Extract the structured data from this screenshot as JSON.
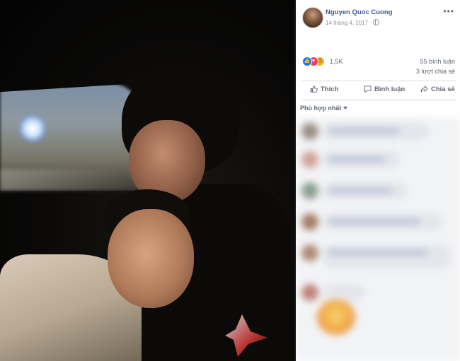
{
  "post": {
    "author": "Nguyen Quoc Cuong",
    "date": "14 tháng 4, 2017 ·",
    "privacy_icon": "globe-icon",
    "more_icon": "more-dots-icon"
  },
  "stats": {
    "reaction_count": "1,5K",
    "reaction_icons": [
      "like-icon",
      "love-icon",
      "sad-icon"
    ],
    "comments": "55 bình luận",
    "shares": "3 lượt chia sẻ"
  },
  "actions": {
    "like": "Thích",
    "comment": "Bình luận",
    "share": "Chia sẻ"
  },
  "comments_section": {
    "sort_label": "Phù hợp nhất"
  },
  "colors": {
    "link_blue": "#385898",
    "like_blue": "#1877f2",
    "love_red": "#f33e58",
    "sad_yellow": "#f7b125",
    "secondary_text": "#606770"
  }
}
